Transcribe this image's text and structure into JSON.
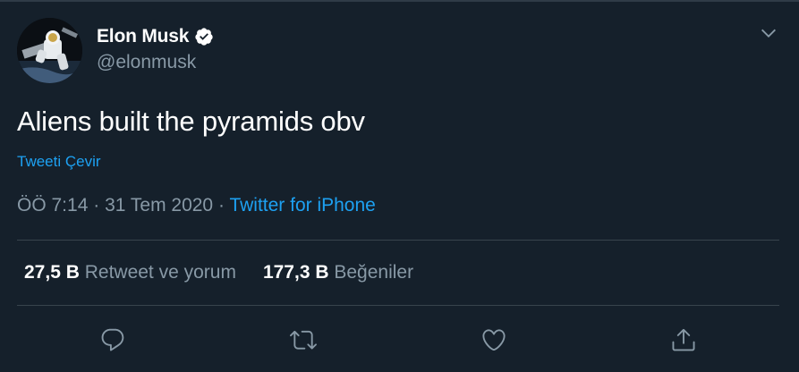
{
  "author": {
    "display_name": "Elon Musk",
    "handle": "@elonmusk",
    "verified": true,
    "avatar_icon": "astronaut-spacewalk-avatar"
  },
  "tweet": {
    "text": "Aliens built the pyramids obv",
    "translate_label": "Tweeti Çevir",
    "time": "ÖÖ 7:14",
    "separator": "·",
    "date": "31 Tem 2020",
    "source": "Twitter for iPhone"
  },
  "stats": {
    "retweets_count": "27,5 B",
    "retweets_label": "Retweet ve yorum",
    "likes_count": "177,3 B",
    "likes_label": "Beğeniler"
  },
  "actions": {
    "icons": [
      "reply-icon",
      "retweet-icon",
      "like-icon",
      "share-icon"
    ]
  },
  "colors": {
    "background": "#15202b",
    "text": "#ffffff",
    "secondary_text": "#8899a6",
    "accent": "#1da1f2",
    "divider": "#38444d"
  }
}
